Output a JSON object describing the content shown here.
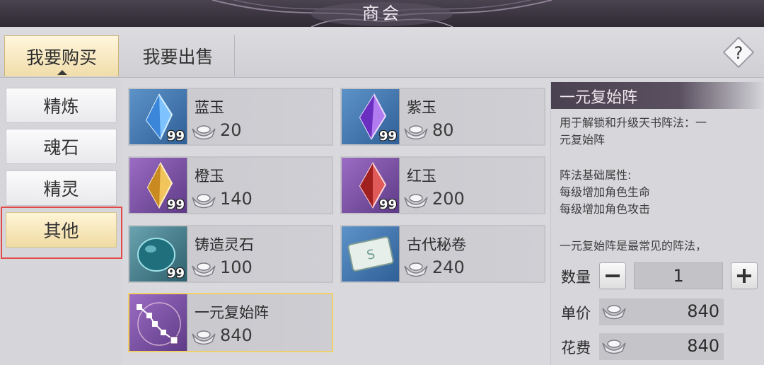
{
  "window": {
    "title": "商会"
  },
  "tabs": {
    "buy": "我要购买",
    "sell": "我要出售"
  },
  "help_label": "?",
  "categories": [
    {
      "label": "精炼"
    },
    {
      "label": "魂石"
    },
    {
      "label": "精灵"
    },
    {
      "label": "其他",
      "active": true
    }
  ],
  "items": [
    {
      "name": "蓝玉",
      "count": "99",
      "price": "20",
      "icon": "blue-crystal-icon",
      "color": "#4f9be0"
    },
    {
      "name": "紫玉",
      "count": "99",
      "price": "80",
      "icon": "purple-crystal-icon",
      "color": "#8a4fd6"
    },
    {
      "name": "橙玉",
      "count": "99",
      "price": "140",
      "icon": "orange-crystal-icon",
      "color": "#e1a23c"
    },
    {
      "name": "红玉",
      "count": "99",
      "price": "200",
      "icon": "red-crystal-icon",
      "color": "#c43a3a"
    },
    {
      "name": "铸造灵石",
      "count": "99",
      "price": "100",
      "icon": "teal-stone-icon",
      "color": "#2a7a86"
    },
    {
      "name": "古代秘卷",
      "count": "",
      "price": "240",
      "icon": "scroll-icon",
      "color": "#d8e4e0"
    },
    {
      "name": "一元复始阵",
      "count": "",
      "price": "840",
      "icon": "formation-icon",
      "color": "#f0c8d8",
      "selected": true
    }
  ],
  "detail": {
    "title": "一元复始阵",
    "desc1": "用于解锁和升级天书阵法：一",
    "desc2": "元复始阵",
    "attr_title": "阵法基础属性:",
    "attr1": "每级增加角色生命",
    "attr2": "每级增加角色攻击",
    "note": "一元复始阵是最常见的阵法，",
    "qty_label": "数量",
    "qty_value": "1",
    "unit_label": "单价",
    "unit_value": "840",
    "cost_label": "花费",
    "cost_value": "840"
  },
  "colors": {
    "accent_gold": "#f0d067",
    "highlight_red": "#e24a4a",
    "header_dark": "#4a4250"
  }
}
